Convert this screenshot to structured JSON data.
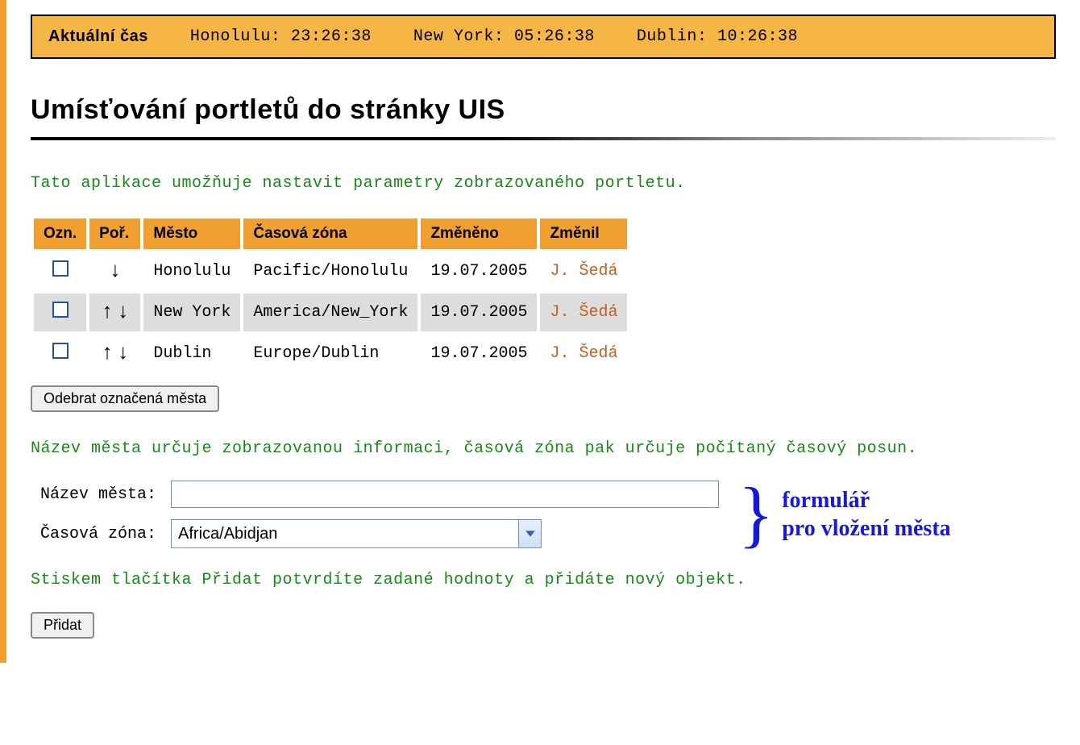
{
  "time_bar": {
    "label": "Aktuální čas",
    "clocks": [
      {
        "city": "Honolulu",
        "time": "23:26:38"
      },
      {
        "city": "New York",
        "time": "05:26:38"
      },
      {
        "city": "Dublin",
        "time": "10:26:38"
      }
    ]
  },
  "page_title": "Umísťování portletů do stránky UIS",
  "hint_top": "Tato aplikace umožňuje nastavit parametry zobrazovaného portletu.",
  "table": {
    "headers": {
      "ozn": "Ozn.",
      "por": "Poř.",
      "mesto": "Město",
      "zona": "Časová zóna",
      "zmeneno": "Změněno",
      "zmenil": "Změnil"
    },
    "rows": [
      {
        "up": false,
        "down": true,
        "mesto": "Honolulu",
        "zona": "Pacific/Honolulu",
        "zmeneno": "19.07.2005",
        "zmenil": "J. Šedá"
      },
      {
        "up": true,
        "down": true,
        "mesto": "New York",
        "zona": "America/New_York",
        "zmeneno": "19.07.2005",
        "zmenil": "J. Šedá"
      },
      {
        "up": true,
        "down": true,
        "mesto": "Dublin",
        "zona": "Europe/Dublin",
        "zmeneno": "19.07.2005",
        "zmenil": "J. Šedá"
      }
    ]
  },
  "remove_button": "Odebrat označená města",
  "hint_mid": "Název města určuje zobrazovanou informaci, časová zóna pak určuje počítaný časový posun.",
  "form": {
    "city_label": "Název města:",
    "city_value": "",
    "zone_label": "Časová zóna:",
    "zone_value": "Africa/Abidjan"
  },
  "brace_annotation": "formulář\npro vložení města",
  "hint_bottom": "Stiskem tlačítka Přidat potvrdíte zadané hodnoty a přidáte nový objekt.",
  "add_button": "Přidat"
}
